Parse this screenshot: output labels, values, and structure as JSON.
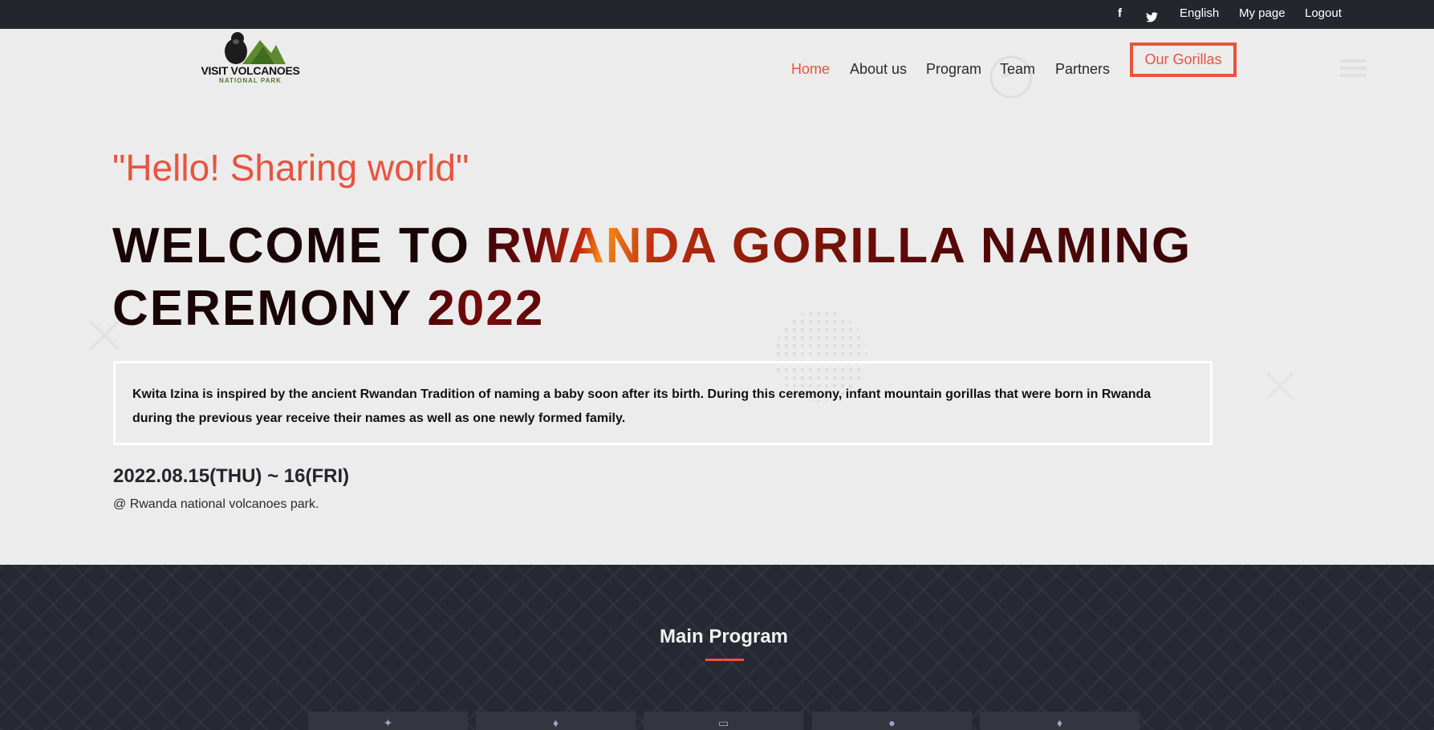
{
  "topbar": {
    "facebook_icon": "f",
    "twitter_icon": "twitter-icon",
    "language": "English",
    "my_page": "My page",
    "logout": "Logout"
  },
  "logo": {
    "brand": "VISIT VOLCANOES",
    "sub": "NATIONAL PARK"
  },
  "nav": {
    "items": [
      "Home",
      "About us",
      "Program",
      "Team",
      "Partners"
    ],
    "cta": "Our Gorillas",
    "accent": "#e8543e"
  },
  "hero": {
    "greeting": "\"Hello! Sharing world\"",
    "headline_a": "WELCOME TO ",
    "headline_b": "RWANDA GORILLA NAMING",
    "headline_c": "CEREMONY ",
    "headline_d": "2022",
    "description": "Kwita Izina is inspired by the ancient Rwandan Tradition of naming a baby soon after its birth. During this ceremony, infant mountain gorillas that were born in Rwanda during the previous year receive their names as well as one newly formed family.",
    "date": "2022.08.15(THU) ~ 16(FRI)",
    "venue": "@ Rwanda national volcanoes park."
  },
  "program": {
    "title": "Main Program",
    "cards": [
      "program-card-1",
      "program-card-2",
      "program-card-3",
      "program-card-4",
      "program-card-5"
    ]
  }
}
